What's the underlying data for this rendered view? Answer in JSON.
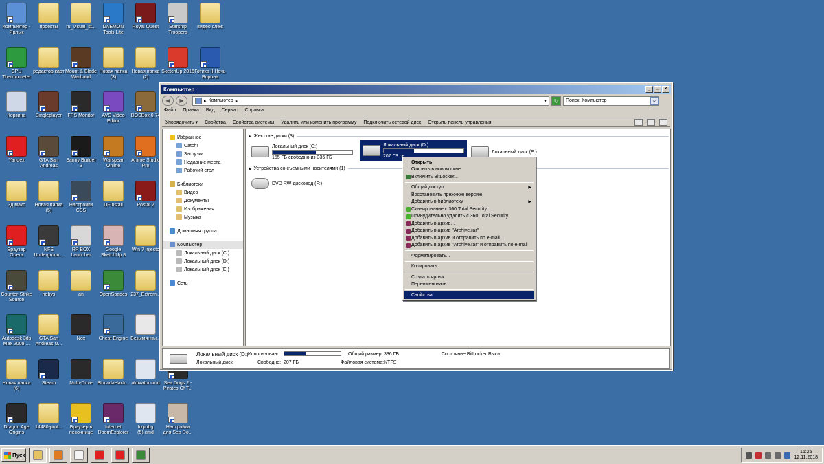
{
  "desktop": {
    "icons": [
      {
        "label": "Компьютер - Ярлык",
        "icon": "computer-icon",
        "color": "#5b8fd6",
        "shortcut": true
      },
      {
        "label": "проекты",
        "icon": "folder-icon",
        "color": "#e3c460",
        "shortcut": false
      },
      {
        "label": "ru_visual_st...",
        "icon": "folder-icon",
        "color": "#e3c460",
        "shortcut": false
      },
      {
        "label": "DAEMON Tools Lite",
        "icon": "daemon-tools-icon",
        "color": "#2a78c8",
        "shortcut": true
      },
      {
        "label": "Royal Quest",
        "icon": "royal-quest-icon",
        "color": "#7a1a1a",
        "shortcut": true
      },
      {
        "label": "Starship Troopers",
        "icon": "starship-troopers-icon",
        "color": "#c9c9c9",
        "shortcut": true
      },
      {
        "label": "видео слеж",
        "icon": "folder-icon",
        "color": "#e3c460",
        "shortcut": false
      },
      {
        "label": "CPU Thermometer",
        "icon": "thermometer-icon",
        "color": "#2e9a40",
        "shortcut": true
      },
      {
        "label": "редактор карт",
        "icon": "folder-icon",
        "color": "#e3c460",
        "shortcut": false
      },
      {
        "label": "Mount & Blade Warband",
        "icon": "mount-blade-icon",
        "color": "#5a3a22",
        "shortcut": true
      },
      {
        "label": "Новая папка (3)",
        "icon": "folder-icon",
        "color": "#e3c460",
        "shortcut": false
      },
      {
        "label": "Новая папка (2)",
        "icon": "folder-icon",
        "color": "#e3c460",
        "shortcut": false
      },
      {
        "label": "SketchUp 2016",
        "icon": "sketchup-icon",
        "color": "#d93a2b",
        "shortcut": true
      },
      {
        "label": "Готика II Ночь Ворона",
        "icon": "gothic-icon",
        "color": "#2a5ab0",
        "shortcut": true
      },
      {
        "label": "Корзина",
        "icon": "recycle-bin-icon",
        "color": "#cfd8e6",
        "shortcut": false
      },
      {
        "label": "Singleplayer",
        "icon": "singleplayer-icon",
        "color": "#6a3a2a",
        "shortcut": true
      },
      {
        "label": "FPS Monitor",
        "icon": "fps-monitor-icon",
        "color": "#2a2a2a",
        "shortcut": true
      },
      {
        "label": "AVS Video Editor",
        "icon": "avs-video-icon",
        "color": "#7a4ac0",
        "shortcut": true
      },
      {
        "label": "DOSBox 0.74",
        "icon": "dosbox-icon",
        "color": "#8a6a3a",
        "shortcut": true
      },
      {
        "label": "Yandex",
        "icon": "yandex-icon",
        "color": "#e02020",
        "shortcut": true
      },
      {
        "label": "GTA San Andreas",
        "icon": "gta-sa-icon",
        "color": "#5a4a3a",
        "shortcut": true
      },
      {
        "label": "Sanny Builder 3",
        "icon": "sanny-builder-icon",
        "color": "#1a1a1a",
        "shortcut": true
      },
      {
        "label": "Warspear Online",
        "icon": "warspear-icon",
        "color": "#c47a20",
        "shortcut": true
      },
      {
        "label": "Anime Studio Pro",
        "icon": "anime-studio-icon",
        "color": "#e07020",
        "shortcut": true
      },
      {
        "label": "3д макс",
        "icon": "folder-icon",
        "color": "#e3c460",
        "shortcut": false
      },
      {
        "label": "Новая папка (5)",
        "icon": "folder-icon",
        "color": "#e3c460",
        "shortcut": false
      },
      {
        "label": "Настройки CSS",
        "icon": "steam-settings-icon",
        "color": "#3a4a5a",
        "shortcut": true
      },
      {
        "label": "DFInstall",
        "icon": "folder-icon",
        "color": "#e3c460",
        "shortcut": false
      },
      {
        "label": "Postal 2",
        "icon": "postal-icon",
        "color": "#8a1a1a",
        "shortcut": true
      },
      {
        "label": "Браузер Opera",
        "icon": "opera-icon",
        "color": "#e02020",
        "shortcut": true
      },
      {
        "label": "NFS Undergroun...",
        "icon": "nfs-icon",
        "color": "#3a3a3a",
        "shortcut": true
      },
      {
        "label": "RP BOX Launcher",
        "icon": "rp-box-icon",
        "color": "#d8d8d8",
        "shortcut": true
      },
      {
        "label": "Google SketchUp 8",
        "icon": "sketchup-icon",
        "color": "#d8b4b4",
        "shortcut": true
      },
      {
        "label": "Win 7 injecto",
        "icon": "folder-icon",
        "color": "#e3c460",
        "shortcut": false
      },
      {
        "label": "Counter-Strike Source",
        "icon": "cs-source-icon",
        "color": "#4a4a3a",
        "shortcut": true
      },
      {
        "label": "hebys",
        "icon": "folder-icon",
        "color": "#e3c460",
        "shortcut": false
      },
      {
        "label": "an",
        "icon": "folder-icon",
        "color": "#e3c460",
        "shortcut": false
      },
      {
        "label": "OpenSpades",
        "icon": "openspades-icon",
        "color": "#3a8a3a",
        "shortcut": true
      },
      {
        "label": "237_Extrem...",
        "icon": "folder-icon",
        "color": "#e3c460",
        "shortcut": false
      },
      {
        "label": "Autodesk 3ds Max 2009 ...",
        "icon": "3ds-max-icon",
        "color": "#1a6a6a",
        "shortcut": true
      },
      {
        "label": "GTA San Andreas U...",
        "icon": "folder-icon",
        "color": "#e3c460",
        "shortcut": false
      },
      {
        "label": "Nox",
        "icon": "nox-icon",
        "color": "#2a2a2a",
        "shortcut": false
      },
      {
        "label": "Cheat Engine",
        "icon": "cheat-engine-icon",
        "color": "#3a6a9a",
        "shortcut": true
      },
      {
        "label": "Безымянны...",
        "icon": "image-file-icon",
        "color": "#e8e8e8",
        "shortcut": false
      },
      {
        "label": "Новая папка (6)",
        "icon": "folder-icon",
        "color": "#e3c460",
        "shortcut": false
      },
      {
        "label": "Steam",
        "icon": "steam-icon",
        "color": "#1a2a4a",
        "shortcut": true
      },
      {
        "label": "Multi-Drive",
        "icon": "nox-multidrive-icon",
        "color": "#2a2a2a",
        "shortcut": false
      },
      {
        "label": "BlocadaHack...",
        "icon": "folder-icon",
        "color": "#e3c460",
        "shortcut": false
      },
      {
        "label": "aktivator.cmd",
        "icon": "cmd-gear-icon",
        "color": "#dfe6f0",
        "shortcut": false
      },
      {
        "label": "Sea Dogs 2 - Pirates Of T...",
        "icon": "sea-dogs-icon",
        "color": "#2a2a2a",
        "shortcut": true
      },
      {
        "label": "Dragon Age Origins",
        "icon": "dragon-age-icon",
        "color": "#2a2a2a",
        "shortcut": true
      },
      {
        "label": "14480-prot...",
        "icon": "folder-icon",
        "color": "#e3c460",
        "shortcut": false
      },
      {
        "label": "Браузер в песочнице",
        "icon": "sandbox-browser-icon",
        "color": "#e8c020",
        "shortcut": true
      },
      {
        "label": "Internet DoomExplorer",
        "icon": "doom-explorer-icon",
        "color": "#6a2a6a",
        "shortcut": true
      },
      {
        "label": "fixpubg (5).cmd",
        "icon": "cmd-gear-icon",
        "color": "#dfe6f0",
        "shortcut": false
      },
      {
        "label": "Настройки для Sea Do...",
        "icon": "sea-dogs-settings-icon",
        "color": "#c8b8a8",
        "shortcut": true
      }
    ]
  },
  "window": {
    "title": "Компьютер",
    "address": "Компьютер",
    "search_placeholder": "Поиск: Компьютер",
    "menu": [
      "Файл",
      "Правка",
      "Вид",
      "Сервис",
      "Справка"
    ],
    "commands": [
      "Упорядочить ▾",
      "Свойства",
      "Свойства системы",
      "Удалить или изменить программу",
      "Подключить сетевой диск",
      "Открыть панель управления"
    ],
    "nav": {
      "favorites": {
        "label": "Избранное",
        "items": [
          "Catch!",
          "Загрузки",
          "Недавние места",
          "Рабочий стол"
        ]
      },
      "libraries": {
        "label": "Библиотеки",
        "items": [
          "Видео",
          "Документы",
          "Изображения",
          "Музыка"
        ]
      },
      "homegroup": "Домашняя группа",
      "computer": {
        "label": "Компьютер",
        "items": [
          "Локальный диск (C:)",
          "Локальный диск (D:)",
          "Локальный диск (E:)"
        ]
      },
      "network": "Сеть"
    },
    "groups": {
      "hdd": "Жесткие диски (3)",
      "removable": "Устройства со съемными носителями (1)"
    },
    "drives": [
      {
        "name": "Локальный диск (C:)",
        "free": "155 ГБ свободно из 336 ГБ",
        "used_fraction": 0.54,
        "selected": false
      },
      {
        "name": "Локальный диск (D:)",
        "free": "207 ГБ св",
        "used_fraction": 0.38,
        "selected": true
      },
      {
        "name": "Локальный диск (E:)",
        "free": "",
        "used_fraction": null,
        "selected": false
      }
    ],
    "dvd": {
      "name": "DVD RW дисковод (F:)"
    },
    "details": {
      "name": "Локальный диск (D:)",
      "type": "Локальный диск",
      "used_label": "Использовано:",
      "used_fraction": 0.38,
      "free_label": "Свободно:",
      "free_value": "207 ГБ",
      "total_label": "Общий размер:",
      "total_value": "336 ГБ",
      "fs_label": "Файловая система:",
      "fs_value": "NTFS",
      "bitlocker_label": "Состояние BitLocker:",
      "bitlocker_value": "Выкл."
    }
  },
  "context_menu": {
    "items": [
      {
        "label": "Открыть",
        "bold": true
      },
      {
        "label": "Открыть в новом окне"
      },
      {
        "label": "Включить BitLocker...",
        "icon": "bitlocker-shield-icon",
        "icon_color": "#3a7a3a"
      },
      {
        "sep": true
      },
      {
        "label": "Общий доступ",
        "submenu": true
      },
      {
        "label": "Восстановить прежнюю версию"
      },
      {
        "label": "Добавить в библиотеку",
        "submenu": true
      },
      {
        "label": "Сканирование с 360 Total Security",
        "icon": "360-security-icon",
        "icon_color": "#4ab030"
      },
      {
        "label": "Принудительно удалить с  360 Total Security",
        "icon": "360-security-icon",
        "icon_color": "#4ab030"
      },
      {
        "label": "Добавить в архив...",
        "icon": "winrar-icon",
        "icon_color": "#8a2a5a"
      },
      {
        "label": "Добавить в архив \"Archive.rar\"",
        "icon": "winrar-icon",
        "icon_color": "#8a2a5a"
      },
      {
        "label": "Добавить в архив и отправить по e-mail...",
        "icon": "winrar-icon",
        "icon_color": "#8a2a5a"
      },
      {
        "label": "Добавить в архив \"Archive.rar\" и отправить по e-mail",
        "icon": "winrar-icon",
        "icon_color": "#8a2a5a"
      },
      {
        "sep": true
      },
      {
        "label": "Форматировать..."
      },
      {
        "sep": true
      },
      {
        "label": "Копировать"
      },
      {
        "sep": true
      },
      {
        "label": "Создать ярлык"
      },
      {
        "label": "Переименовать"
      },
      {
        "sep": true
      },
      {
        "label": "Свойства",
        "selected": true
      }
    ]
  },
  "taskbar": {
    "start_label": "Пуск",
    "items": [
      {
        "icon": "explorer-folder-icon",
        "color": "#e3c460",
        "active": true
      },
      {
        "icon": "media-player-icon",
        "color": "#e07a20",
        "active": false
      },
      {
        "icon": "blank-document-icon",
        "color": "#f4f4f4",
        "active": false
      },
      {
        "icon": "opera-icon",
        "color": "#e02020",
        "active": false
      },
      {
        "icon": "yandex-icon",
        "color": "#e02020",
        "active": false
      },
      {
        "icon": "screen-icon",
        "color": "#3a8a3a",
        "active": false
      }
    ],
    "tray": {
      "icons": [
        {
          "icon": "chevron-up-icon",
          "color": "#555555"
        },
        {
          "icon": "flag-tray-icon",
          "color": "#c03030"
        },
        {
          "icon": "network-tray-icon",
          "color": "#6a6a6a"
        },
        {
          "icon": "volume-tray-icon",
          "color": "#6a6a6a"
        },
        {
          "icon": "keyboard-tray-icon",
          "color": "#3a6ab0"
        }
      ],
      "time": "15:25",
      "date": "12.11.2018"
    }
  }
}
